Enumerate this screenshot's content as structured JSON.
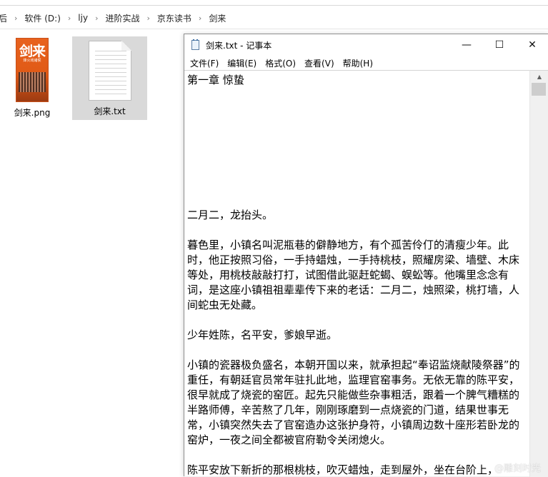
{
  "explorer": {
    "breadcrumb": [
      "软件 (D:)",
      "ljy",
      "进阶实战",
      "京东读书",
      "剑来"
    ],
    "partial_left": "后",
    "files": [
      {
        "name": "剑来.png",
        "icon": "image-file-icon",
        "cover_title": "剑来",
        "cover_subtitle": "烽火戏诸侯"
      },
      {
        "name": "剑来.txt",
        "icon": "text-file-icon"
      }
    ]
  },
  "notepad": {
    "title": "剑来.txt - 记事本",
    "controls": {
      "minimize": "—",
      "maximize": "☐",
      "close": "✕"
    },
    "menu": [
      "文件(F)",
      "编辑(E)",
      "格式(O)",
      "查看(V)",
      "帮助(H)"
    ],
    "content": {
      "heading": "第一章 惊蛰",
      "lines": [
        "二月二，龙抬头。",
        "暮色里，小镇名叫泥瓶巷的僻静地方，有个孤苦伶仃的清瘦少年。此时，他正按照习俗，一手持蜡烛，一手持桃枝，照耀房梁、墙壁、木床等处，用桃枝敲敲打打，试图借此驱赶蛇蝎、蜈蚣等。他嘴里念念有词，是这座小镇祖祖辈辈传下来的老话：二月二，烛照梁，桃打墙，人间蛇虫无处藏。",
        "少年姓陈，名平安，爹娘早逝。",
        "小镇的瓷器极负盛名，本朝开国以来，就承担起“奉诏监烧献陵祭器”的重任，有朝廷官员常年驻扎此地，监理官窑事务。无依无靠的陈平安，很早就成了烧瓷的窑匠。起先只能做些杂事粗活，跟着一个脾气糟糕的半路师傅，辛苦熬了几年，刚刚琢磨到一点烧瓷的门道，结果世事无常，小镇突然失去了官窑造办这张护身符，小镇周边数十座形若卧龙的窑炉，一夜之间全都被官府勒令关闭熄火。",
        "陈平安放下新折的那根桃枝，吹灭蜡烛，走到屋外，坐在台阶上，"
      ]
    }
  },
  "watermark": "@雕刻时光"
}
